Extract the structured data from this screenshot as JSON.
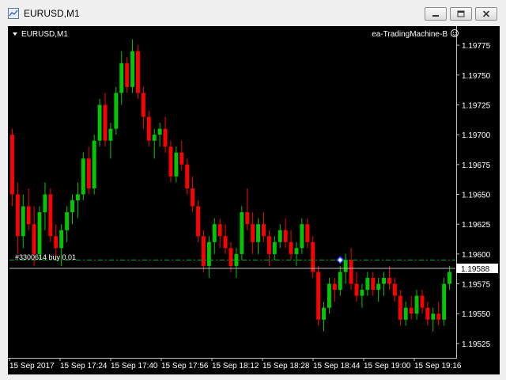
{
  "window": {
    "title": "EURUSD,M1",
    "buttons": [
      "minimize",
      "restore",
      "close"
    ]
  },
  "chart": {
    "symbol_label": "EURUSD,M1",
    "expert_label": "ea-TradingMachine-B",
    "expert_icon": "smiley-icon",
    "order_label": "#33006​14 buy 0.01",
    "current_price": "1.19588",
    "colors": {
      "background": "#000000",
      "bull": "#00c800",
      "bear": "#ff0000",
      "doji": "#ffffff",
      "order_line": "#00b400",
      "bid_line": "#c0c0c0",
      "axis_text": "#ffffff"
    }
  },
  "chart_data": {
    "type": "candlestick",
    "symbol": "EURUSD",
    "timeframe": "M1",
    "y_tick_labels": [
      "1.19775",
      "1.19750",
      "1.19725",
      "1.19700",
      "1.19675",
      "1.19650",
      "1.19625",
      "1.19600",
      "1.19575",
      "1.19550",
      "1.19525"
    ],
    "y_tick_values": [
      1.19775,
      1.1975,
      1.19725,
      1.197,
      1.19675,
      1.1965,
      1.19625,
      1.196,
      1.19575,
      1.1955,
      1.19525
    ],
    "ylim": [
      1.19513,
      1.19791
    ],
    "x_tick_labels": [
      "15 Sep 2017",
      "15 Sep 17:24",
      "15 Sep 17:40",
      "15 Sep 17:56",
      "15 Sep 18:12",
      "15 Sep 18:28",
      "15 Sep 18:44",
      "15 Sep 19:00",
      "15 Sep 19:16"
    ],
    "order_price": 1.19595,
    "bid_price": 1.19588,
    "candles": [
      [
        1.197,
        1.19705,
        1.1964,
        1.1965
      ],
      [
        1.1965,
        1.1966,
        1.196,
        1.19615
      ],
      [
        1.19615,
        1.1965,
        1.19605,
        1.1964
      ],
      [
        1.1964,
        1.19655,
        1.1962,
        1.19625
      ],
      [
        1.19625,
        1.1964,
        1.1959,
        1.196
      ],
      [
        1.196,
        1.1964,
        1.19595,
        1.19635
      ],
      [
        1.19635,
        1.1966,
        1.1962,
        1.1965
      ],
      [
        1.1965,
        1.19655,
        1.1961,
        1.19615
      ],
      [
        1.19615,
        1.19625,
        1.19595,
        1.19605
      ],
      [
        1.19605,
        1.19625,
        1.1959,
        1.1962
      ],
      [
        1.1962,
        1.1964,
        1.1961,
        1.19635
      ],
      [
        1.19635,
        1.1965,
        1.19625,
        1.19645
      ],
      [
        1.19645,
        1.1966,
        1.1963,
        1.1965
      ],
      [
        1.1965,
        1.19685,
        1.19645,
        1.1968
      ],
      [
        1.1968,
        1.1969,
        1.1965,
        1.19655
      ],
      [
        1.19655,
        1.197,
        1.1965,
        1.19695
      ],
      [
        1.19695,
        1.1973,
        1.1969,
        1.19725
      ],
      [
        1.19725,
        1.19735,
        1.1969,
        1.19695
      ],
      [
        1.19695,
        1.1971,
        1.1968,
        1.19705
      ],
      [
        1.19705,
        1.1974,
        1.197,
        1.19735
      ],
      [
        1.19735,
        1.1977,
        1.19725,
        1.1976
      ],
      [
        1.1976,
        1.19765,
        1.19735,
        1.1974
      ],
      [
        1.1974,
        1.1978,
        1.19735,
        1.1977
      ],
      [
        1.1977,
        1.19775,
        1.1973,
        1.19735
      ],
      [
        1.19735,
        1.1974,
        1.19705,
        1.19715
      ],
      [
        1.19715,
        1.1972,
        1.1969,
        1.19695
      ],
      [
        1.19695,
        1.19705,
        1.1968,
        1.197
      ],
      [
        1.197,
        1.1971,
        1.1969,
        1.19705
      ],
      [
        1.19705,
        1.19715,
        1.19685,
        1.1969
      ],
      [
        1.1969,
        1.19695,
        1.1966,
        1.19665
      ],
      [
        1.19665,
        1.1969,
        1.1966,
        1.19685
      ],
      [
        1.19685,
        1.19695,
        1.1967,
        1.19675
      ],
      [
        1.19675,
        1.1968,
        1.1965,
        1.19655
      ],
      [
        1.19655,
        1.19665,
        1.19635,
        1.1964
      ],
      [
        1.1964,
        1.19645,
        1.1961,
        1.19615
      ],
      [
        1.19615,
        1.1962,
        1.19585,
        1.1959
      ],
      [
        1.1959,
        1.19615,
        1.1958,
        1.1961
      ],
      [
        1.1961,
        1.1963,
        1.196,
        1.19625
      ],
      [
        1.19625,
        1.1963,
        1.19605,
        1.19615
      ],
      [
        1.19615,
        1.19625,
        1.196,
        1.19605
      ],
      [
        1.19605,
        1.1961,
        1.19585,
        1.1959
      ],
      [
        1.1959,
        1.19605,
        1.1958,
        1.196
      ],
      [
        1.196,
        1.1964,
        1.19595,
        1.19635
      ],
      [
        1.19635,
        1.19655,
        1.1962,
        1.19625
      ],
      [
        1.19625,
        1.19635,
        1.196,
        1.1961
      ],
      [
        1.1961,
        1.1963,
        1.196,
        1.19625
      ],
      [
        1.19625,
        1.19635,
        1.1961,
        1.19615
      ],
      [
        1.19615,
        1.1962,
        1.1959,
        1.196
      ],
      [
        1.196,
        1.19615,
        1.19595,
        1.1961
      ],
      [
        1.1961,
        1.19625,
        1.19605,
        1.1962
      ],
      [
        1.1962,
        1.1963,
        1.19605,
        1.1961
      ],
      [
        1.1961,
        1.1962,
        1.19595,
        1.196
      ],
      [
        1.196,
        1.1961,
        1.1959,
        1.19605
      ],
      [
        1.19605,
        1.1963,
        1.196,
        1.19625
      ],
      [
        1.19625,
        1.1963,
        1.19605,
        1.1961
      ],
      [
        1.1961,
        1.19615,
        1.1958,
        1.19585
      ],
      [
        1.19585,
        1.1959,
        1.1954,
        1.19545
      ],
      [
        1.19545,
        1.1956,
        1.19535,
        1.19555
      ],
      [
        1.19555,
        1.1958,
        1.1955,
        1.19575
      ],
      [
        1.19575,
        1.1958,
        1.1956,
        1.1957
      ],
      [
        1.1957,
        1.1959,
        1.19565,
        1.19585
      ],
      [
        1.19585,
        1.196,
        1.19575,
        1.19595
      ],
      [
        1.19595,
        1.19605,
        1.1957,
        1.19575
      ],
      [
        1.19575,
        1.19585,
        1.1956,
        1.19565
      ],
      [
        1.19565,
        1.19575,
        1.19555,
        1.1957
      ],
      [
        1.1957,
        1.19585,
        1.19565,
        1.1958
      ],
      [
        1.1958,
        1.19585,
        1.19565,
        1.1957
      ],
      [
        1.1957,
        1.1958,
        1.1956,
        1.19575
      ],
      [
        1.19575,
        1.19585,
        1.19565,
        1.1958
      ],
      [
        1.1958,
        1.1959,
        1.1957,
        1.19575
      ],
      [
        1.19575,
        1.1958,
        1.1956,
        1.19565
      ],
      [
        1.19565,
        1.1957,
        1.1954,
        1.19545
      ],
      [
        1.19545,
        1.1956,
        1.1954,
        1.19555
      ],
      [
        1.19555,
        1.19565,
        1.19545,
        1.1955
      ],
      [
        1.1955,
        1.1957,
        1.19545,
        1.19565
      ],
      [
        1.19565,
        1.1957,
        1.1955,
        1.19555
      ],
      [
        1.19555,
        1.1956,
        1.1954,
        1.19545
      ],
      [
        1.19545,
        1.19555,
        1.19535,
        1.1955
      ],
      [
        1.1955,
        1.1956,
        1.1954,
        1.19545
      ],
      [
        1.19545,
        1.1958,
        1.1954,
        1.19575
      ],
      [
        1.19575,
        1.1959,
        1.1957,
        1.19585
      ]
    ]
  }
}
